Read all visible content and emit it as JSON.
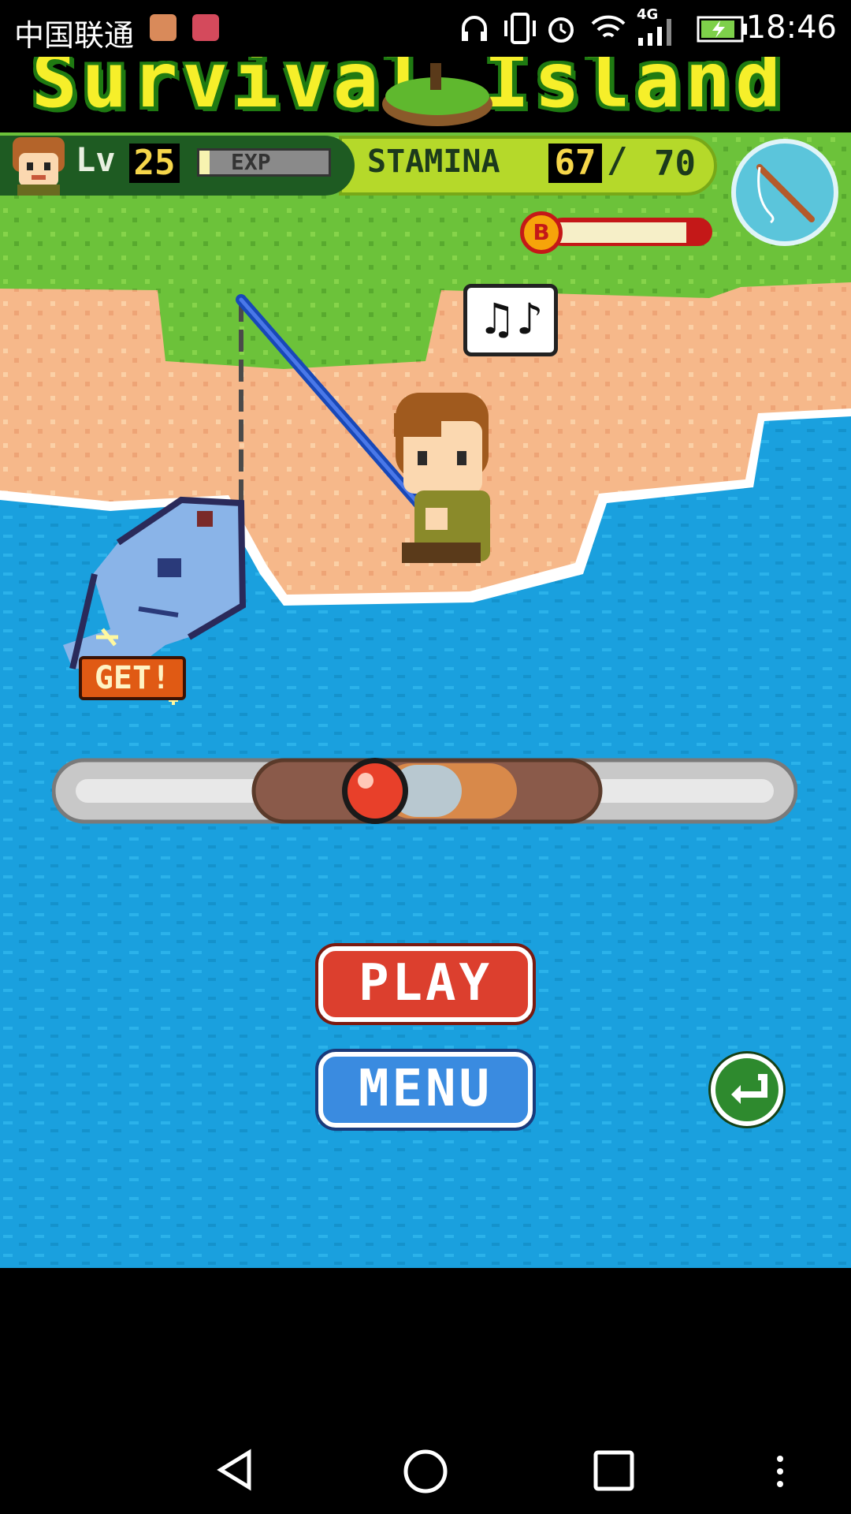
{
  "status_bar": {
    "carrier": "中国联通",
    "network": "4G",
    "time": "18:46",
    "icons": [
      "listen-app-icon",
      "health-app-icon",
      "headphones-icon",
      "vibrate-icon",
      "alarm-icon",
      "wifi-icon",
      "signal-icon",
      "battery-charging-icon"
    ]
  },
  "banner": {
    "title": "Survival Island"
  },
  "hud": {
    "level_label": "Lv",
    "level": "25",
    "exp_label": "EXP",
    "exp_fraction": 0.08,
    "stamina_label": "STAMINA",
    "stamina_current": "67",
    "stamina_separator": "/",
    "stamina_max": "70",
    "tension_coin": "B",
    "tension_fraction": 0.88
  },
  "scene": {
    "speech_bubble": "♫♪",
    "catch_badge": "GET!"
  },
  "buttons": {
    "play": "PLAY",
    "menu": "MENU"
  },
  "colors": {
    "water": "#1aa0de",
    "grass": "#6cc23a",
    "sand": "#f6b88a",
    "play": "#dc3f2e",
    "menu": "#3a8be0",
    "back": "#2e8a2e"
  }
}
